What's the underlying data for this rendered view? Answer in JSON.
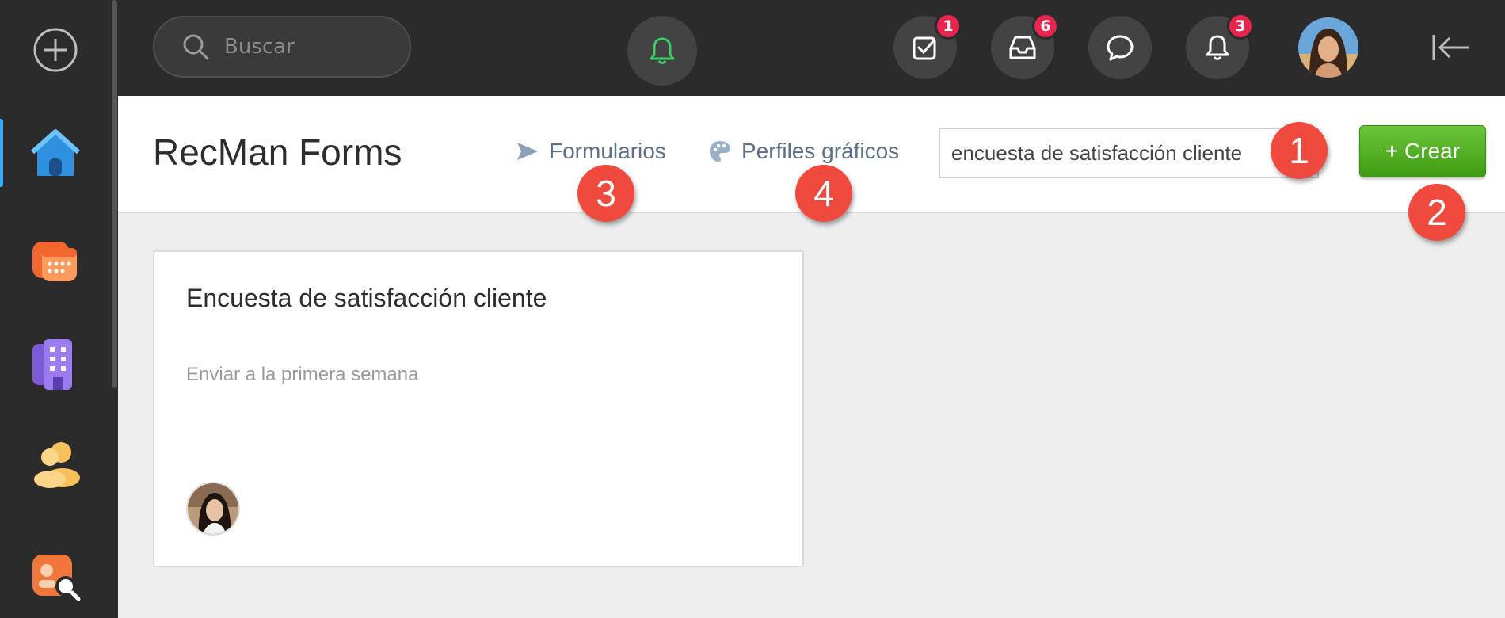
{
  "topbar": {
    "search_placeholder": "Buscar",
    "badges": {
      "tasks": "1",
      "inbox": "6",
      "notifications": "3"
    }
  },
  "header": {
    "title": "RecMan Forms",
    "nav": {
      "forms": "Formularios",
      "graphic_profiles": "Perfiles gráficos"
    },
    "search_value": "encuesta de satisfacción cliente",
    "create_label": "+ Crear"
  },
  "markers": {
    "m1": "1",
    "m2": "2",
    "m3": "3",
    "m4": "4"
  },
  "card": {
    "title": "Encuesta de satisfacción cliente",
    "subtitle": "Enviar a la primera semana"
  },
  "colors": {
    "accent_green": "#4caf1f",
    "badge_red": "#e8254e",
    "marker_red": "#f04a3e",
    "sidebar_active": "#3aa8ff"
  }
}
